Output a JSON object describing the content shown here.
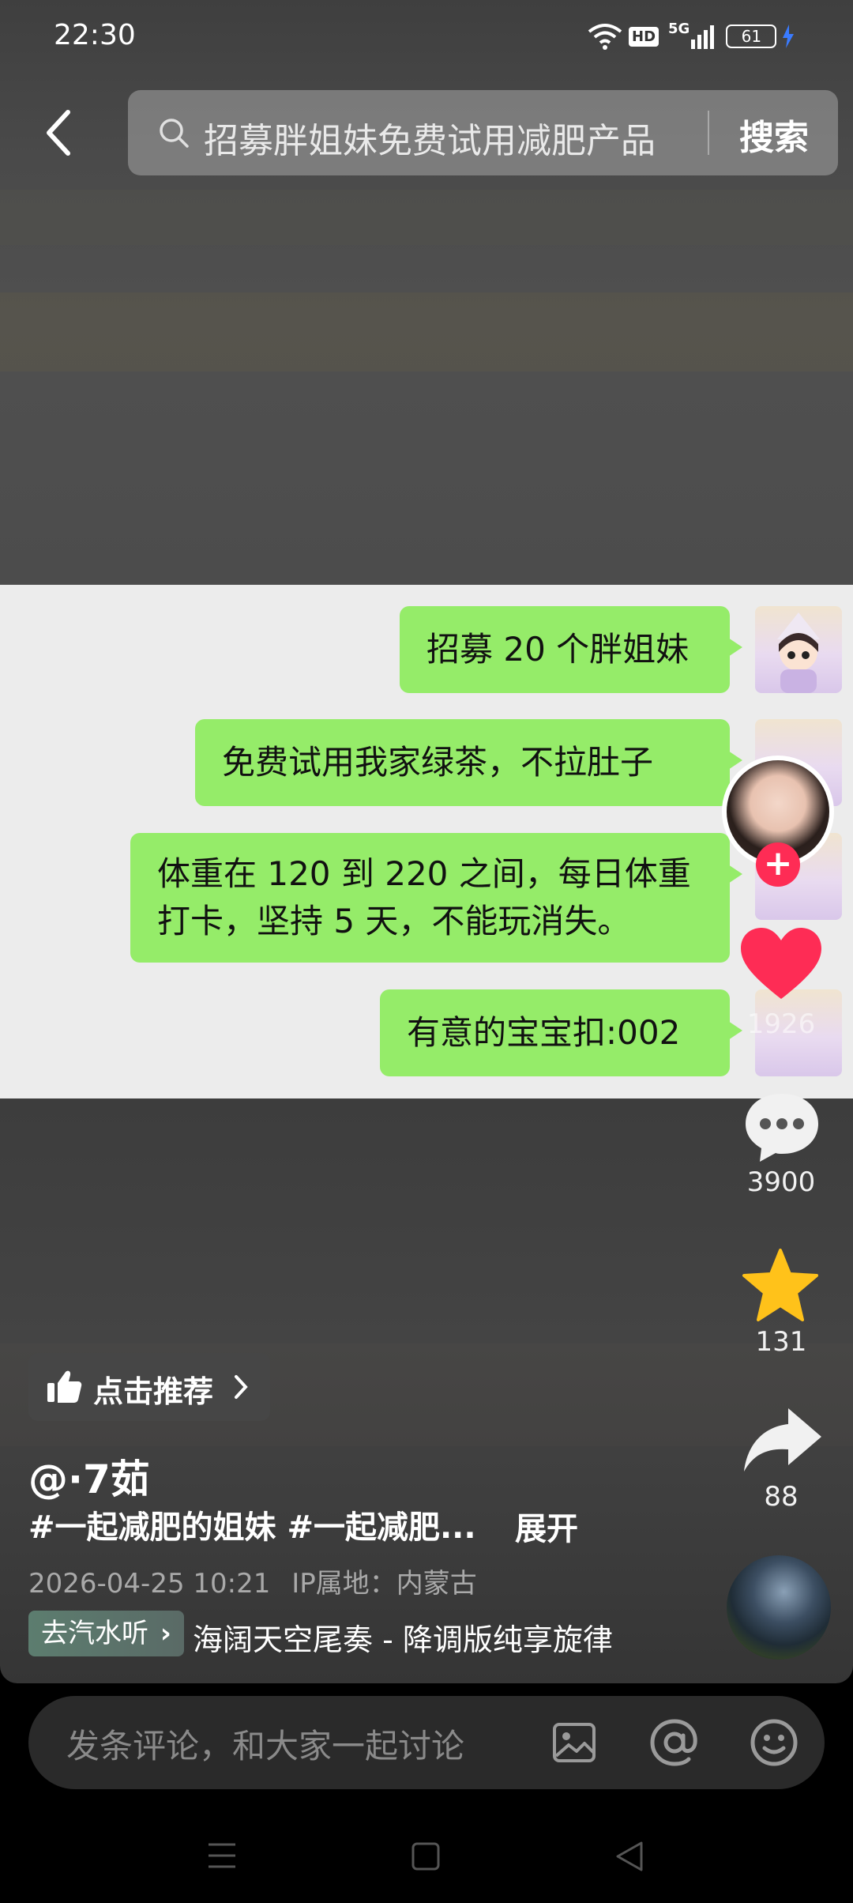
{
  "status_bar": {
    "time": "22:30",
    "hd_label": "HD",
    "network_label": "5G",
    "battery_level": "61"
  },
  "search": {
    "query": "招募胖姐妹免费试用减肥产品",
    "button_label": "搜索"
  },
  "chat": {
    "messages": [
      "招募 20 个胖姐妹",
      "免费试用我家绿茶，不拉肚子",
      "体重在 120 到 220 之间，每日体重",
      "打卡，坚持 5 天，不能玩消失。",
      "有意的宝宝扣:002"
    ]
  },
  "rail": {
    "like_count": "1926",
    "comment_count": "3900",
    "favorite_count": "131",
    "share_count": "88"
  },
  "post": {
    "recommend_label": "点击推荐",
    "author": "@·7茹",
    "caption": "#一起减肥的姐妹 #一起减肥...",
    "expand_label": "展开",
    "date": "2026-04-25 10:21",
    "ip_location": "IP属地：内蒙古",
    "music_tag": "去汽水听",
    "music_title": "海阔天空尾奏 - 降调版纯享旋律"
  },
  "comment_bar": {
    "placeholder": "发条评论，和大家一起讨论"
  },
  "colors": {
    "bubble_green": "#95ec69",
    "like_red": "#fe2c55",
    "favorite_yellow": "#ffc21a"
  },
  "icons": [
    "back-icon",
    "search-icon",
    "thumb-up-icon",
    "chevron-right-icon",
    "heart-icon",
    "comment-icon",
    "star-icon",
    "share-icon",
    "image-icon",
    "at-icon",
    "emoji-icon",
    "menu-icon",
    "home-icon",
    "back-triangle-icon",
    "wifi-icon",
    "signal-icon",
    "battery-icon",
    "charging-icon"
  ]
}
